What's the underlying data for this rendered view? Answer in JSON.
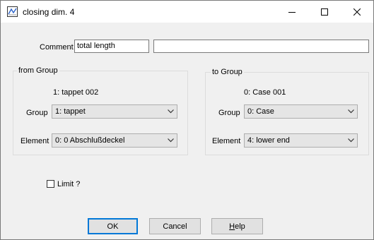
{
  "window": {
    "title": "closing dim. 4"
  },
  "comment": {
    "label": "Comment",
    "value": "total length",
    "value2": ""
  },
  "from_group": {
    "title": "from Group",
    "current": "1: tappet 002",
    "group_label": "Group",
    "group_value": "1: tappet",
    "element_label": "Element",
    "element_value": "0: 0 Abschlußdeckel"
  },
  "to_group": {
    "title": "to Group",
    "current": "0: Case 001",
    "group_label": "Group",
    "group_value": "0: Case",
    "element_label": "Element",
    "element_value": "4: lower end"
  },
  "limit": {
    "label": "Limit ?",
    "checked": false
  },
  "buttons": {
    "ok": "OK",
    "cancel": "Cancel",
    "help_first": "H",
    "help_rest": "elp"
  }
}
